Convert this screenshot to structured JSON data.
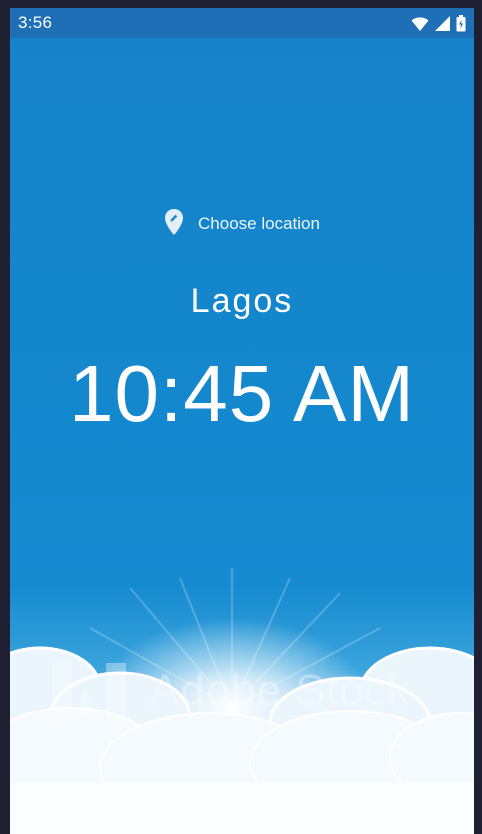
{
  "status_bar": {
    "time": "3:56",
    "icons": [
      "wifi-icon",
      "cell-signal-icon",
      "battery-icon"
    ]
  },
  "location": {
    "label": "Choose location",
    "icon": "location-pin-edit-icon"
  },
  "city": "Lagos",
  "time": "10:45 AM",
  "background": {
    "watermark": "Adobe Stock"
  },
  "colors": {
    "sky_blue": "#1487cd",
    "status_bar": "#1f6fb6",
    "text": "#ffffff"
  }
}
